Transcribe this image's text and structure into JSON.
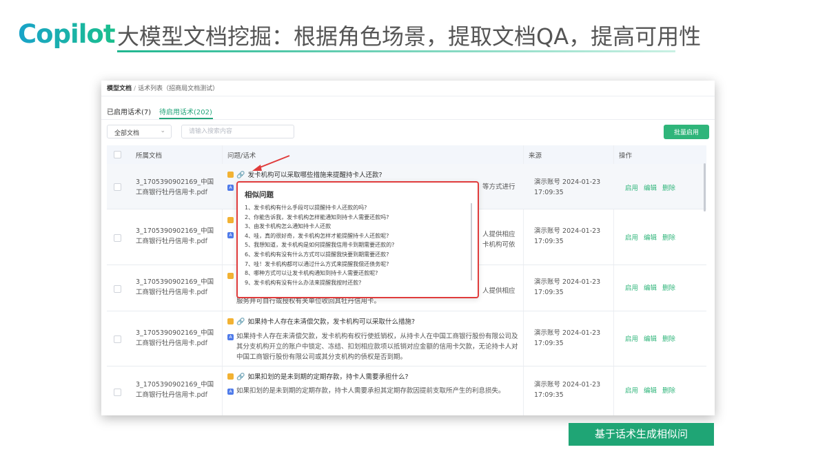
{
  "brand": "Copilot",
  "slide_title": "大模型文档挖掘：根据角色场景，提取文档QA，提高可用性",
  "breadcrumb": {
    "root": "模型文档",
    "sep": "/",
    "current": "话术列表（招商局文档测试）"
  },
  "tabs": {
    "enabled": "已启用话术(7)",
    "pending": "待启用话术(202)"
  },
  "filter": {
    "select_value": "全部文档",
    "search_placeholder": "请输入搜索内容",
    "batch_button": "批量启用"
  },
  "table": {
    "headers": {
      "doc": "所属文档",
      "qa": "问题/话术",
      "source": "来源",
      "ops": "操作"
    },
    "ops": {
      "enable": "启用",
      "edit": "编辑",
      "delete": "删除"
    },
    "rows": [
      {
        "doc": "3_1705390902169_中国工商银行牡丹信用卡.pdf",
        "question": "发卡机构可以采取哪些措施来提醒持卡人还款?",
        "answer_tail": "等方式进行",
        "source": "演示账号 2024-01-23 17:09:35"
      },
      {
        "doc": "3_1705390902169_中国工商银行牡丹信用卡.pdf",
        "answer_tail1": "人提供相应",
        "answer_tail2": "卡机构可依",
        "source": "演示账号 2024-01-23 17:09:35"
      },
      {
        "doc": "3_1705390902169_中国工商银行牡丹信用卡.pdf",
        "answer_tail": "人提供相应",
        "answer_line2": "服务并可自行或授权有关单位收回其牡丹信用卡。",
        "source": "演示账号 2024-01-23 17:09:35"
      },
      {
        "doc": "3_1705390902169_中国工商银行牡丹信用卡.pdf",
        "question": "如果持卡人存在未清偿欠款，发卡机构可以采取什么措施?",
        "answer": "如果持卡人存在未清偿欠款，发卡机构有权行使抵销权，从持卡人在中国工商银行股份有限公司及其分支机构开立的账户中锁定、冻结、扣划相应款项以抵销对应金额的信用卡欠款，无论持卡人对中国工商银行股份有限公司或其分支机构的债权是否到期。",
        "source": "演示账号 2024-01-23 17:09:35"
      },
      {
        "doc": "3_1705390902169_中国工商银行牡丹信用卡.pdf",
        "question": "如果扣划的是未到期的定期存款，持卡人需要承担什么?",
        "answer": "如果扣划的是未到期的定期存款，持卡人需要承担其定期存款因提前支取所产生的利息损失。",
        "source": "演示账号 2024-01-23 17:09:35"
      }
    ]
  },
  "popup": {
    "title": "相似问题",
    "items": [
      "1、发卡机构有什么手段可以提醒持卡人还款的吗?",
      "2、你能告诉我，发卡机构怎样能通知到持卡人需要还款吗?",
      "3、由发卡机构怎么通知持卡人还款",
      "4、哇，真的很好奇，发卡机构怎样才能提醒持卡人还款呢?",
      "5、我想知道，发卡机构是如何提醒我信用卡到期需要还款的?",
      "6、发卡机构有没有什么方式可以提醒我快要到期需要还款?",
      "7、哇！发卡机构都可以通过什么方式来提醒我偿还债务呢?",
      "8、哪种方式可以让发卡机构通知到持卡人需要还款呢?",
      "9、发卡机构有没有什么办法来提醒我按时还款?"
    ]
  },
  "banner": "基于话术生成相似问",
  "colors": {
    "accent": "#2fb57a",
    "popup_border": "#e03b3b",
    "brand_start": "#19a3c9",
    "brand_end": "#1bbf8c"
  }
}
